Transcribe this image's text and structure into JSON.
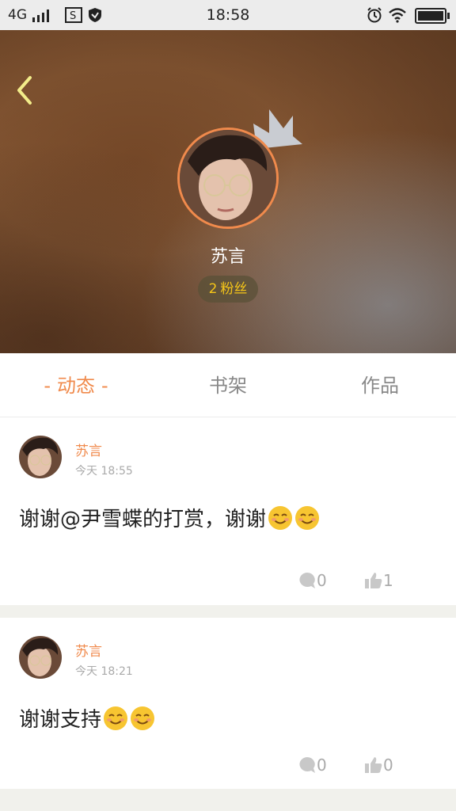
{
  "status_bar": {
    "network": "4G",
    "time": "18:58"
  },
  "profile": {
    "name": "苏言",
    "fans_count": "2",
    "fans_label": "粉丝"
  },
  "tabs": [
    {
      "label": "动态",
      "active": true
    },
    {
      "label": "书架",
      "active": false
    },
    {
      "label": "作品",
      "active": false
    }
  ],
  "posts": [
    {
      "author": "苏言",
      "time": "今天 18:55",
      "text": "谢谢@尹雪蝶的打赏，谢谢",
      "emoji_count": 2,
      "comments": "0",
      "likes": "1"
    },
    {
      "author": "苏言",
      "time": "今天 18:21",
      "text": "谢谢支持",
      "emoji_count": 2,
      "comments": "0",
      "likes": "0"
    }
  ],
  "colors": {
    "accent": "#f08a4c",
    "fans_text": "#f5c518",
    "muted": "#aaaaaa"
  }
}
